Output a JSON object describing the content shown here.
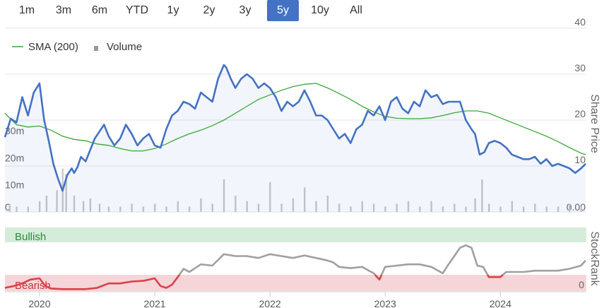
{
  "range_selector": {
    "buttons": [
      {
        "label": "1m",
        "active": false
      },
      {
        "label": "3m",
        "active": false
      },
      {
        "label": "6m",
        "active": false
      },
      {
        "label": "YTD",
        "active": false
      },
      {
        "label": "1y",
        "active": false
      },
      {
        "label": "2y",
        "active": false
      },
      {
        "label": "3y",
        "active": false
      },
      {
        "label": "5y",
        "active": true
      },
      {
        "label": "10y",
        "active": false
      },
      {
        "label": "All",
        "active": false
      }
    ]
  },
  "colors": {
    "price_line": "#4472c4",
    "sma_line": "#3aa63a",
    "volume_bar": "#c8c8cc",
    "bullish_band": "#d6ecda",
    "bearish_band": "#f5d5d7",
    "rank_gray": "#a0a0a0",
    "rank_red": "#d9414a",
    "active_button": "#4472c4"
  },
  "chart_data": [
    {
      "type": "line",
      "ylabel": "Share Price",
      "legend": {
        "placement": "top-left",
        "items": [
          "SMA (200)",
          "Volume"
        ]
      },
      "y_ticks": [
        10,
        20,
        30,
        40
      ],
      "ylim": [
        0,
        40
      ],
      "volume_ticks": [
        "0",
        "10m",
        "20m",
        "30m"
      ],
      "volume_max": 30,
      "volume_zero_right": "0.00",
      "x_tick_labels": [
        "2020",
        "2021",
        "2022",
        "2023",
        "2024"
      ],
      "xlim": [
        2019.7,
        2024.74
      ],
      "grid": true,
      "series": [
        {
          "name": "Price",
          "x": [
            2019.7,
            2019.75,
            2019.8,
            2019.85,
            2019.9,
            2019.95,
            2020.0,
            2020.04,
            2020.08,
            2020.12,
            2020.16,
            2020.2,
            2020.24,
            2020.28,
            2020.3,
            2020.33,
            2020.36,
            2020.4,
            2020.44,
            2020.48,
            2020.52,
            2020.56,
            2020.6,
            2020.65,
            2020.7,
            2020.75,
            2020.8,
            2020.85,
            2020.9,
            2020.95,
            2021.0,
            2021.05,
            2021.1,
            2021.15,
            2021.2,
            2021.25,
            2021.3,
            2021.35,
            2021.4,
            2021.45,
            2021.5,
            2021.55,
            2021.6,
            2021.62,
            2021.66,
            2021.7,
            2021.75,
            2021.8,
            2021.85,
            2021.9,
            2021.95,
            2022.0,
            2022.05,
            2022.1,
            2022.15,
            2022.2,
            2022.25,
            2022.3,
            2022.35,
            2022.4,
            2022.45,
            2022.5,
            2022.55,
            2022.6,
            2022.65,
            2022.7,
            2022.75,
            2022.8,
            2022.85,
            2022.9,
            2022.95,
            2023.0,
            2023.05,
            2023.1,
            2023.15,
            2023.2,
            2023.25,
            2023.3,
            2023.35,
            2023.4,
            2023.45,
            2023.5,
            2023.55,
            2023.6,
            2023.65,
            2023.7,
            2023.75,
            2023.78,
            2023.82,
            2023.86,
            2023.9,
            2023.95,
            2024.0,
            2024.05,
            2024.1,
            2024.15,
            2024.2,
            2024.25,
            2024.3,
            2024.35,
            2024.4,
            2024.45,
            2024.5,
            2024.55,
            2024.6,
            2024.65,
            2024.7,
            2024.74
          ],
          "values": [
            16.3,
            20.3,
            19.5,
            25.0,
            21.0,
            26.0,
            28.0,
            20.0,
            15.5,
            10.5,
            7.3,
            4.6,
            8.0,
            9.5,
            8.5,
            9.8,
            12.0,
            11.0,
            13.5,
            16.0,
            17.5,
            19.0,
            16.5,
            14.5,
            16.0,
            19.0,
            17.0,
            14.5,
            16.0,
            17.0,
            14.5,
            14.0,
            18.0,
            21.0,
            22.0,
            24.0,
            23.5,
            22.5,
            26.0,
            25.0,
            24.0,
            29.0,
            32.0,
            31.5,
            29.0,
            27.0,
            29.0,
            30.0,
            29.0,
            27.0,
            28.0,
            27.0,
            25.0,
            22.0,
            24.0,
            23.0,
            24.0,
            26.5,
            24.0,
            21.0,
            21.0,
            20.0,
            18.0,
            16.0,
            17.0,
            15.0,
            18.0,
            19.0,
            22.0,
            21.0,
            23.0,
            20.0,
            24.0,
            25.0,
            22.5,
            21.5,
            24.0,
            23.0,
            26.5,
            25.0,
            25.5,
            23.5,
            24.0,
            24.0,
            24.0,
            20.0,
            18.0,
            17.0,
            12.5,
            13.0,
            15.0,
            15.5,
            15.0,
            14.0,
            12.5,
            12.0,
            11.5,
            11.5,
            12.0,
            10.5,
            11.5,
            10.0,
            10.5,
            10.0,
            9.5,
            8.5,
            9.5,
            10.5
          ]
        },
        {
          "name": "SMA (200)",
          "x": [
            2019.7,
            2019.8,
            2019.9,
            2020.0,
            2020.1,
            2020.2,
            2020.3,
            2020.4,
            2020.5,
            2020.6,
            2020.7,
            2020.8,
            2020.9,
            2021.0,
            2021.1,
            2021.2,
            2021.3,
            2021.4,
            2021.5,
            2021.6,
            2021.7,
            2021.8,
            2021.9,
            2022.0,
            2022.1,
            2022.2,
            2022.3,
            2022.4,
            2022.5,
            2022.6,
            2022.7,
            2022.8,
            2022.9,
            2023.0,
            2023.1,
            2023.2,
            2023.3,
            2023.4,
            2023.5,
            2023.6,
            2023.7,
            2023.8,
            2023.9,
            2024.0,
            2024.1,
            2024.2,
            2024.3,
            2024.4,
            2024.5,
            2024.6,
            2024.7,
            2024.74
          ],
          "values": [
            21.5,
            19.0,
            18.5,
            18.7,
            17.8,
            16.5,
            15.8,
            15.5,
            14.8,
            14.5,
            13.8,
            13.3,
            13.3,
            13.8,
            14.8,
            16.0,
            17.0,
            17.8,
            18.8,
            20.0,
            21.5,
            23.0,
            24.5,
            25.5,
            26.5,
            27.3,
            27.8,
            28.0,
            27.0,
            25.8,
            24.5,
            23.0,
            21.8,
            20.8,
            20.4,
            20.3,
            20.3,
            20.5,
            21.0,
            21.6,
            22.0,
            22.0,
            21.5,
            20.5,
            19.5,
            18.5,
            17.5,
            16.5,
            15.3,
            14.0,
            12.8,
            12.5
          ]
        }
      ],
      "volume": {
        "name": "Volume",
        "x": [
          2019.74,
          2019.8,
          2019.9,
          2020.0,
          2020.06,
          2020.15,
          2020.2,
          2020.23,
          2020.3,
          2020.38,
          2020.44,
          2020.52,
          2020.6,
          2020.7,
          2020.8,
          2020.9,
          2021.0,
          2021.1,
          2021.2,
          2021.3,
          2021.4,
          2021.5,
          2021.6,
          2021.7,
          2021.8,
          2021.9,
          2022.0,
          2022.1,
          2022.2,
          2022.3,
          2022.4,
          2022.5,
          2022.6,
          2022.7,
          2022.8,
          2022.9,
          2023.0,
          2023.1,
          2023.2,
          2023.3,
          2023.4,
          2023.5,
          2023.6,
          2023.7,
          2023.78,
          2023.84,
          2023.9,
          2024.0,
          2024.1,
          2024.2,
          2024.3,
          2024.4,
          2024.5,
          2024.6,
          2024.7
        ],
        "values": [
          3,
          2,
          2,
          4,
          6,
          8,
          16,
          14,
          6,
          4,
          5,
          3,
          2,
          2,
          3,
          2,
          3,
          2,
          4,
          2,
          5,
          3,
          12,
          6,
          4,
          3,
          11,
          3,
          5,
          9,
          4,
          6,
          3,
          2,
          4,
          3,
          2,
          3,
          4,
          2,
          4,
          2,
          3,
          2,
          5,
          12,
          3,
          2,
          4,
          2,
          3,
          2,
          2,
          3,
          2
        ]
      }
    },
    {
      "type": "line",
      "ylabel": "StockRank",
      "bands": [
        "Bullish",
        "Bearish"
      ],
      "y_ticks": [
        0
      ],
      "ylim": [
        0,
        100
      ],
      "x_tick_labels": [
        "2020",
        "2021",
        "2022",
        "2023",
        "2024"
      ],
      "series": [
        {
          "name": "StockRank",
          "x": [
            2019.7,
            2019.78,
            2019.85,
            2019.92,
            2020.0,
            2020.05,
            2020.1,
            2020.2,
            2020.3,
            2020.4,
            2020.5,
            2020.6,
            2020.7,
            2020.8,
            2020.9,
            2021.0,
            2021.05,
            2021.1,
            2021.15,
            2021.2,
            2021.25,
            2021.3,
            2021.4,
            2021.5,
            2021.6,
            2021.7,
            2021.8,
            2021.9,
            2022.0,
            2022.1,
            2022.2,
            2022.3,
            2022.4,
            2022.5,
            2022.55,
            2022.6,
            2022.7,
            2022.8,
            2022.9,
            2022.95,
            2023.0,
            2023.1,
            2023.2,
            2023.3,
            2023.4,
            2023.5,
            2023.55,
            2023.6,
            2023.65,
            2023.7,
            2023.75,
            2023.8,
            2023.85,
            2023.9,
            2024.0,
            2024.05,
            2024.1,
            2024.2,
            2024.3,
            2024.4,
            2024.5,
            2024.6,
            2024.7,
            2024.74
          ],
          "values": [
            5,
            8,
            12,
            18,
            20,
            8,
            4,
            3,
            3,
            3,
            5,
            12,
            12,
            15,
            16,
            20,
            8,
            5,
            10,
            22,
            35,
            30,
            42,
            40,
            58,
            55,
            55,
            52,
            58,
            55,
            52,
            56,
            52,
            48,
            45,
            38,
            36,
            38,
            28,
            18,
            38,
            40,
            42,
            42,
            38,
            28,
            42,
            55,
            68,
            72,
            68,
            40,
            38,
            22,
            22,
            30,
            30,
            30,
            32,
            32,
            32,
            35,
            40,
            48
          ]
        }
      ]
    }
  ]
}
